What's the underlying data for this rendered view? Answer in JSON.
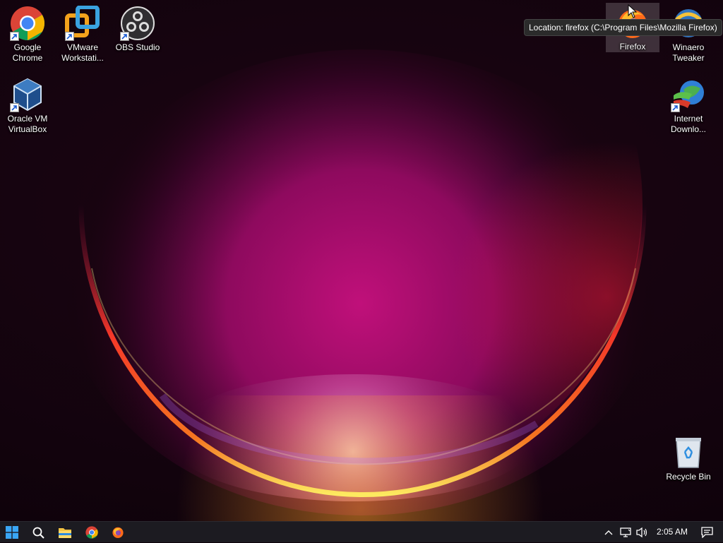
{
  "desktop": {
    "icons": [
      {
        "id": "chrome",
        "label": "Google Chrome",
        "icon": "chrome-icon",
        "shortcut": true
      },
      {
        "id": "vmware",
        "label": "VMware Workstati...",
        "icon": "vmware-icon",
        "shortcut": true
      },
      {
        "id": "obs",
        "label": "OBS Studio",
        "icon": "obs-icon",
        "shortcut": true
      },
      {
        "id": "virtualbox",
        "label": "Oracle VM VirtualBox",
        "icon": "virtualbox-icon",
        "shortcut": true
      },
      {
        "id": "firefox",
        "label": "Firefox",
        "icon": "firefox-icon",
        "shortcut": false,
        "selected": true
      },
      {
        "id": "winaero",
        "label": "Winaero Tweaker",
        "icon": "winaero-icon",
        "shortcut": false
      },
      {
        "id": "idm",
        "label": "Internet Downlo...",
        "icon": "idm-icon",
        "shortcut": true
      },
      {
        "id": "recycle",
        "label": "Recycle Bin",
        "icon": "recycle-bin-icon",
        "shortcut": false
      }
    ]
  },
  "tooltip": {
    "text": "Location: firefox (C:\\Program Files\\Mozilla Firefox)"
  },
  "taskbar": {
    "pinned": [
      {
        "name": "start-button",
        "icon": "windows-logo-icon"
      },
      {
        "name": "search-button",
        "icon": "search-icon"
      },
      {
        "name": "file-explorer-button",
        "icon": "folder-icon"
      },
      {
        "name": "chrome-taskbar-button",
        "icon": "chrome-icon"
      },
      {
        "name": "firefox-taskbar-button",
        "icon": "firefox-icon"
      }
    ],
    "tray": {
      "icons": [
        "chevron-up-icon",
        "network-icon",
        "volume-icon"
      ],
      "clock": "2:05 AM",
      "notification_icon": "notification-icon"
    }
  },
  "colors": {
    "taskbar_bg": "#1c1b21",
    "accent_blue": "#0078d4",
    "wallpaper_magenta": "#c0107a",
    "wallpaper_glow": "#ffd050"
  }
}
